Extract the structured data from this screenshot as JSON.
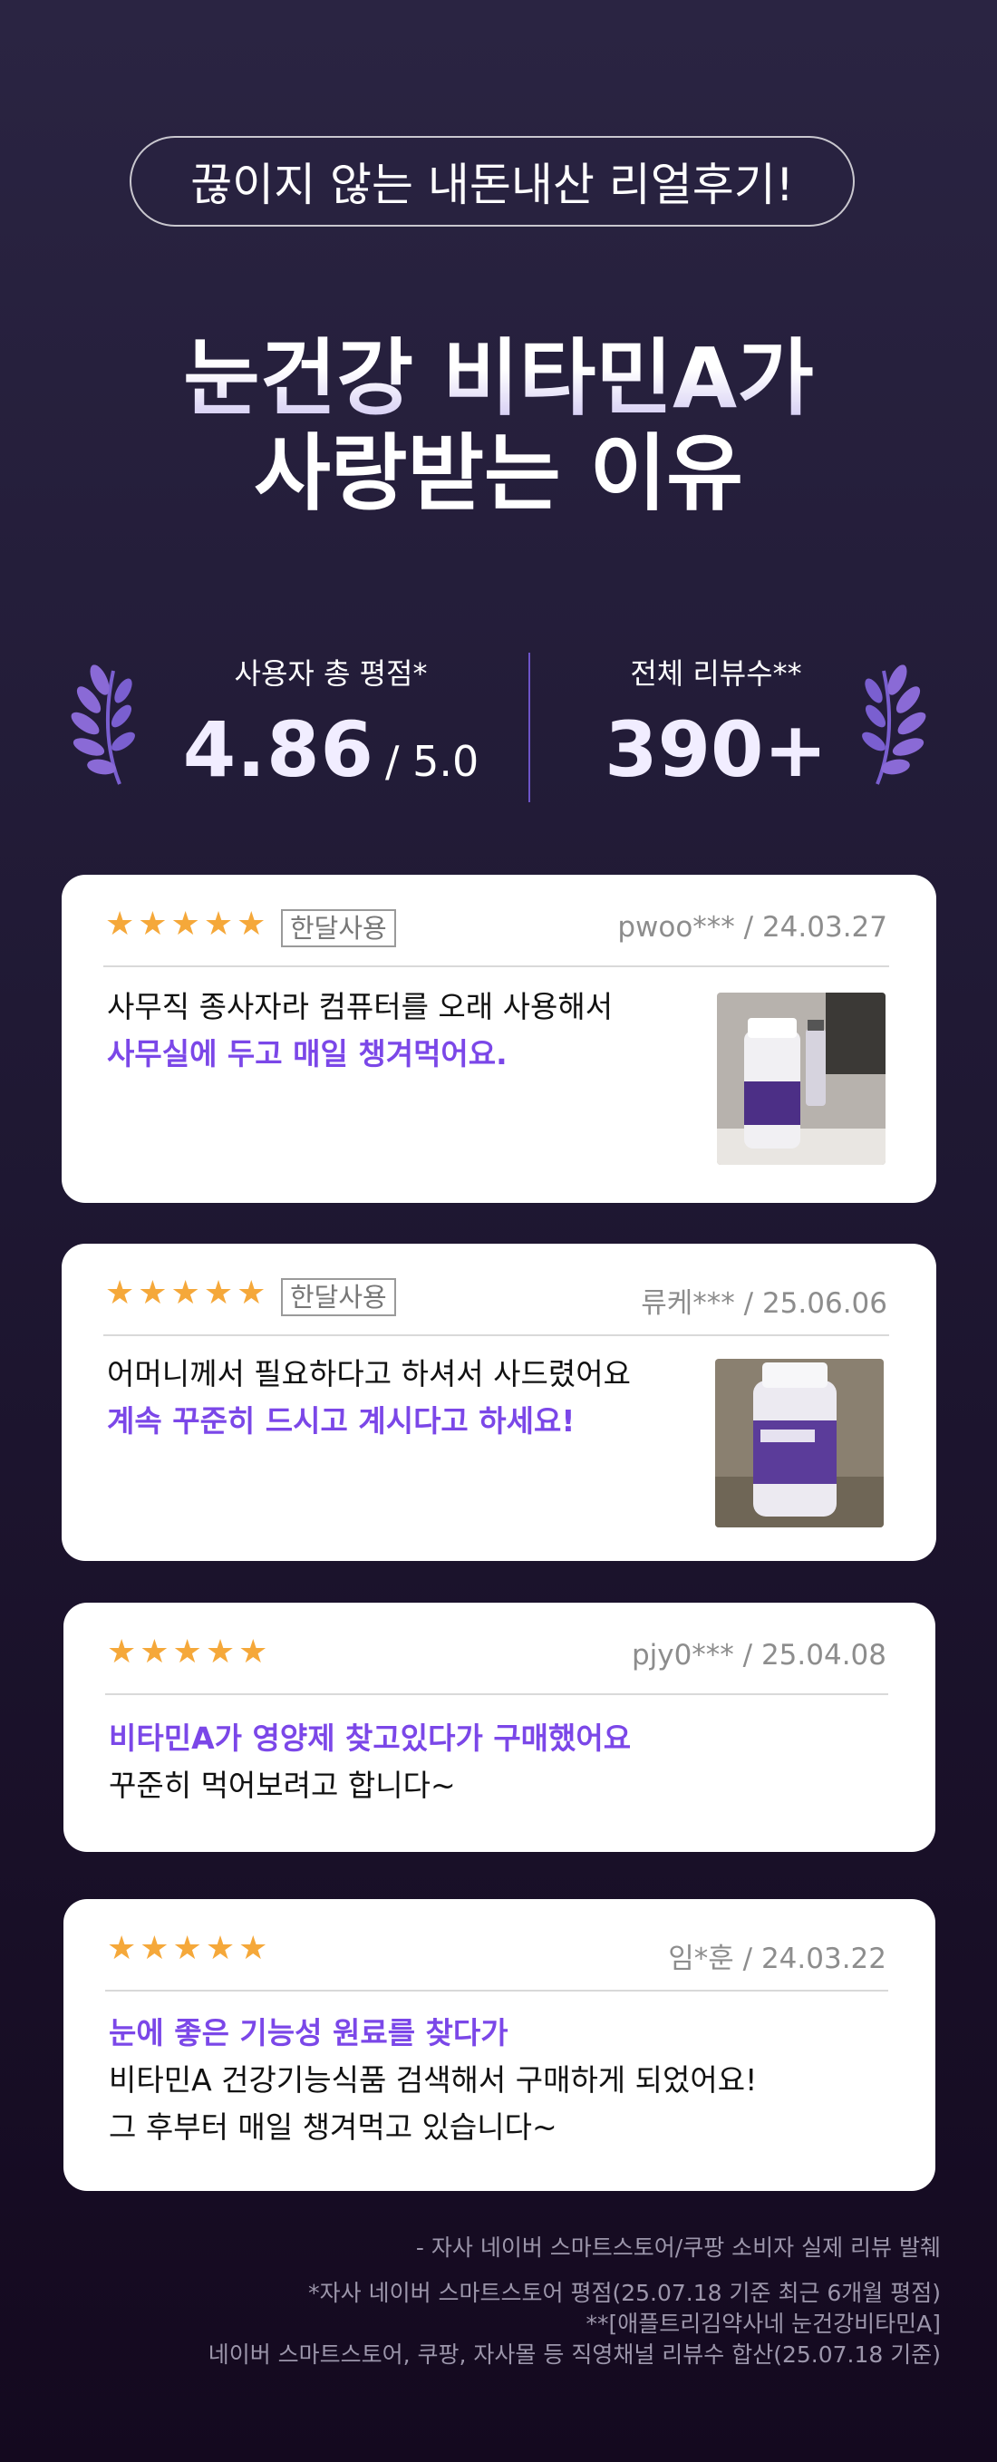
{
  "banner": "끊이지 않는 내돈내산 리얼후기!",
  "headline": {
    "line1": "눈건강 비타민A가",
    "line2": "사랑받는 이유"
  },
  "stats": {
    "rating_label": "사용자 총  평점*",
    "rating_value": "4.86",
    "rating_suffix": "/ 5.0",
    "reviews_label": "전체 리뷰수**",
    "reviews_value": "390+"
  },
  "reviews": [
    {
      "stars": "★★★★★",
      "tag": "한달사용",
      "meta": "pwoo*** / 24.03.27",
      "line1": "사무직 종사자라 컴퓨터를 오래 사용해서",
      "line2": "사무실에 두고 매일 챙겨먹어요."
    },
    {
      "stars": "★★★★★",
      "tag": "한달사용",
      "meta": "류케*** / 25.06.06",
      "line1": "어머니께서 필요하다고 하셔서 사드렸어요",
      "line2": "계속 꾸준히 드시고 계시다고 하세요!"
    },
    {
      "stars": "★★★★★",
      "meta": "pjy0*** / 25.04.08",
      "line1": "비타민A가 영양제 찾고있다가 구매했어요",
      "line2": "꾸준히 먹어보려고 합니다~"
    },
    {
      "stars": "★★★★★",
      "meta": "임*훈 / 24.03.22",
      "line1": "눈에 좋은 기능성 원료를 찾다가",
      "line2": "비타민A 건강기능식품 검색해서 구매하게 되었어요!",
      "line3": "그 후부터 매일 챙겨먹고 있습니다~"
    }
  ],
  "footnotes": {
    "source": "- 자사 네이버 스마트스토어/쿠팡 소비자 실제 리뷰 발췌",
    "note1": "*자사 네이버 스마트스토어 평점(25.07.18 기준 최근 6개월 평점)",
    "note2": "**[애플트리김약사네 눈건강비타민A]",
    "note3": "네이버 스마트스토어, 쿠팡, 자사몰 등 직영채널 리뷰수 합산(25.07.18 기준)"
  },
  "colors": {
    "accent": "#7b47e8",
    "star": "#f5a83a",
    "laurel": "#8a6ad6"
  },
  "icons": {
    "laurel": "laurel-icon",
    "photo": "product-photo"
  }
}
